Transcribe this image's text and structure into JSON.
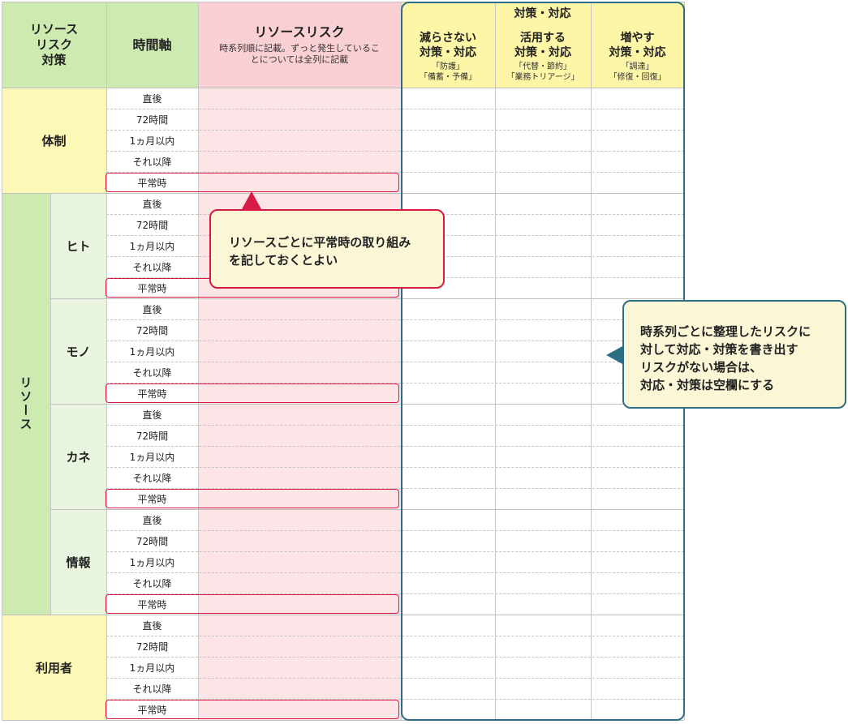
{
  "header": {
    "category": [
      "リソース",
      "リスク",
      "対策"
    ],
    "time_axis": "時間軸",
    "risk_title": "リソースリスク",
    "risk_note": [
      "時系列順に記載。ずっと発生しているこ",
      "とについては全列に記載"
    ],
    "measures_title": "対策・対応",
    "measures": [
      {
        "title": [
          "減らさない",
          "対策・対応"
        ],
        "note": [
          "「防護」",
          "「備蓄・予備」"
        ]
      },
      {
        "title": [
          "活用する",
          "対策・対応"
        ],
        "note": [
          "「代替・節約」",
          "「業務トリアージ」"
        ]
      },
      {
        "title": [
          "増やす",
          "対策・対応"
        ],
        "note": [
          "「調達」",
          "「修復・回復」"
        ]
      }
    ]
  },
  "time_rows": [
    "直後",
    "72時間",
    "1ヵ月以内",
    "それ以降",
    "平常時"
  ],
  "groups": [
    {
      "label": "体制"
    },
    {
      "label": "リソース",
      "subgroups": [
        "ヒト",
        "モノ",
        "カネ",
        "情報"
      ]
    },
    {
      "label": "利用者"
    }
  ],
  "callouts": {
    "left": [
      "リソースごとに平常時の取り組み",
      "を記しておくとよい"
    ],
    "right": [
      "時系列ごとに整理したリスクに",
      "対して対応・対策を書き出す",
      "リスクがない場合は、",
      "対応・対策は空欄にする"
    ]
  },
  "colors": {
    "frame": "#2e6e84",
    "highlight_border": "#d81b45",
    "header_green": "#cdeab0",
    "header_pink": "#fbd0d5",
    "header_yellow": "#fdf6a6"
  }
}
